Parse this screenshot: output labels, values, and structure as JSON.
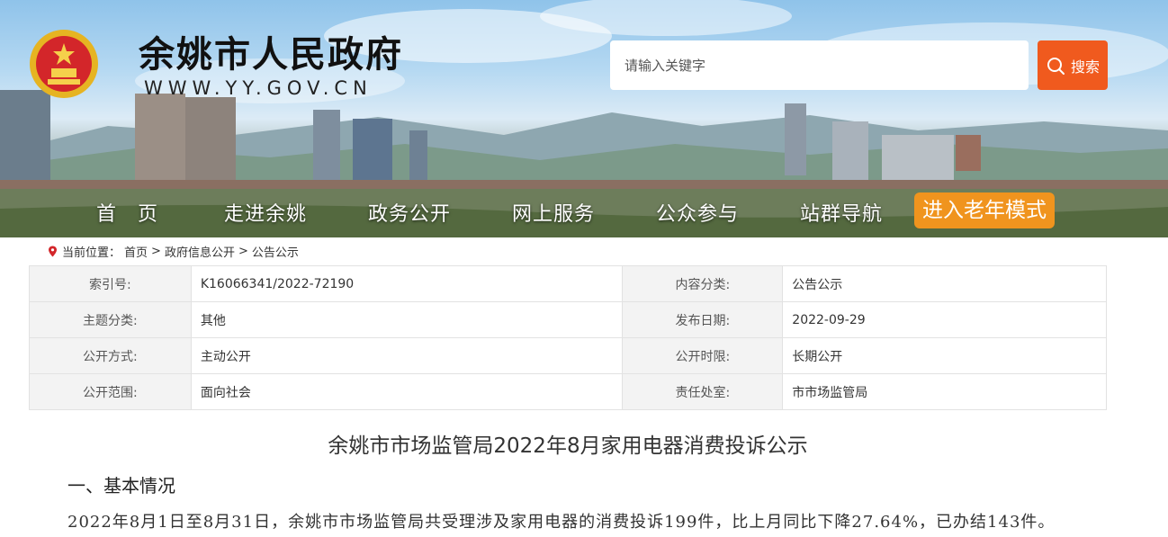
{
  "header": {
    "site_title": "余姚市人民政府",
    "site_url": "WWW.YY.GOV.CN",
    "emblem_icon": "national-emblem-icon"
  },
  "search": {
    "placeholder": "请输入关键字",
    "button_label": "搜索",
    "button_icon": "search-icon",
    "button_color": "#f05a1e"
  },
  "nav": {
    "items": [
      {
        "label": "首　页"
      },
      {
        "label": "走进余姚"
      },
      {
        "label": "政务公开"
      },
      {
        "label": "网上服务"
      },
      {
        "label": "公众参与"
      },
      {
        "label": "站群导航"
      }
    ],
    "elder_mode_label": "进入老年模式",
    "elder_mode_color": "#f0941e"
  },
  "breadcrumb": {
    "icon": "location-pin-icon",
    "prefix": "当前位置：",
    "items": [
      "首页",
      "政府信息公开",
      "公告公示"
    ],
    "separator": ">"
  },
  "meta": {
    "rows": [
      {
        "label1": "索引号:",
        "value1": "K16066341/2022-72190",
        "label2": "内容分类:",
        "value2": "公告公示"
      },
      {
        "label1": "主题分类:",
        "value1": "其他",
        "label2": "发布日期:",
        "value2": "2022-09-29"
      },
      {
        "label1": "公开方式:",
        "value1": "主动公开",
        "label2": "公开时限:",
        "value2": "长期公开"
      },
      {
        "label1": "公开范围:",
        "value1": "面向社会",
        "label2": "责任处室:",
        "value2": "市市场监管局"
      }
    ]
  },
  "article": {
    "title": "余姚市市场监管局2022年8月家用电器消费投诉公示",
    "section1_heading": "一、基本情况",
    "section1_para": "2022年8月1日至8月31日，余姚市市场监管局共受理涉及家用电器的消费投诉199件，比上月同比下降27.64%，已办结143件。"
  }
}
